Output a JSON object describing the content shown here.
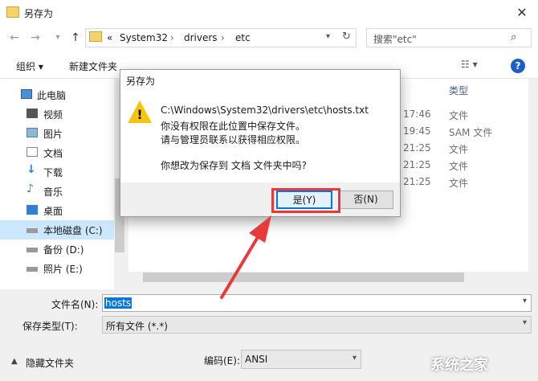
{
  "window": {
    "title": "另存为"
  },
  "nav": {
    "breadcrumb": [
      "«",
      "System32",
      "›",
      "drivers",
      "›",
      "etc"
    ],
    "search_placeholder": "搜索\"etc\""
  },
  "toolbar": {
    "organize": "组织 ▾",
    "new_folder": "新建文件夹"
  },
  "sidebar": {
    "items": [
      {
        "label": "此电脑",
        "icon": "computer-icon"
      },
      {
        "label": "视频",
        "icon": "video-icon"
      },
      {
        "label": "图片",
        "icon": "picture-icon"
      },
      {
        "label": "文档",
        "icon": "document-icon"
      },
      {
        "label": "下载",
        "icon": "download-icon"
      },
      {
        "label": "音乐",
        "icon": "music-icon"
      },
      {
        "label": "桌面",
        "icon": "desktop-icon"
      },
      {
        "label": "本地磁盘 (C:)",
        "icon": "drive-icon"
      },
      {
        "label": "备份 (D:)",
        "icon": "drive-icon"
      },
      {
        "label": "照片 (E:)",
        "icon": "drive-icon"
      }
    ]
  },
  "filelist": {
    "type_header": "类型",
    "rows": [
      {
        "time": "17:46",
        "type": "文件"
      },
      {
        "time": "19:45",
        "type": "SAM 文件"
      },
      {
        "time": "21:25",
        "type": "文件"
      },
      {
        "time": "21:25",
        "type": "文件"
      },
      {
        "time": "21:25",
        "type": "文件"
      }
    ]
  },
  "form": {
    "filename_label": "文件名(N):",
    "filename_value": "hosts",
    "filetype_label": "保存类型(T):",
    "filetype_value": "所有文件  (*.*)",
    "hide_folders": "隐藏文件夹",
    "encoding_label": "编码(E):",
    "encoding_value": "ANSI"
  },
  "dialog": {
    "title": "另存为",
    "path": "C:\\Windows\\System32\\drivers\\etc\\hosts.txt",
    "line1": "你没有权限在此位置中保存文件。",
    "line2": "请与管理员联系以获得相应权限。",
    "question": "你想改为保存到 文档 文件夹中吗?",
    "yes": "是(Y)",
    "no": "否(N)"
  },
  "watermark": "系统之家"
}
